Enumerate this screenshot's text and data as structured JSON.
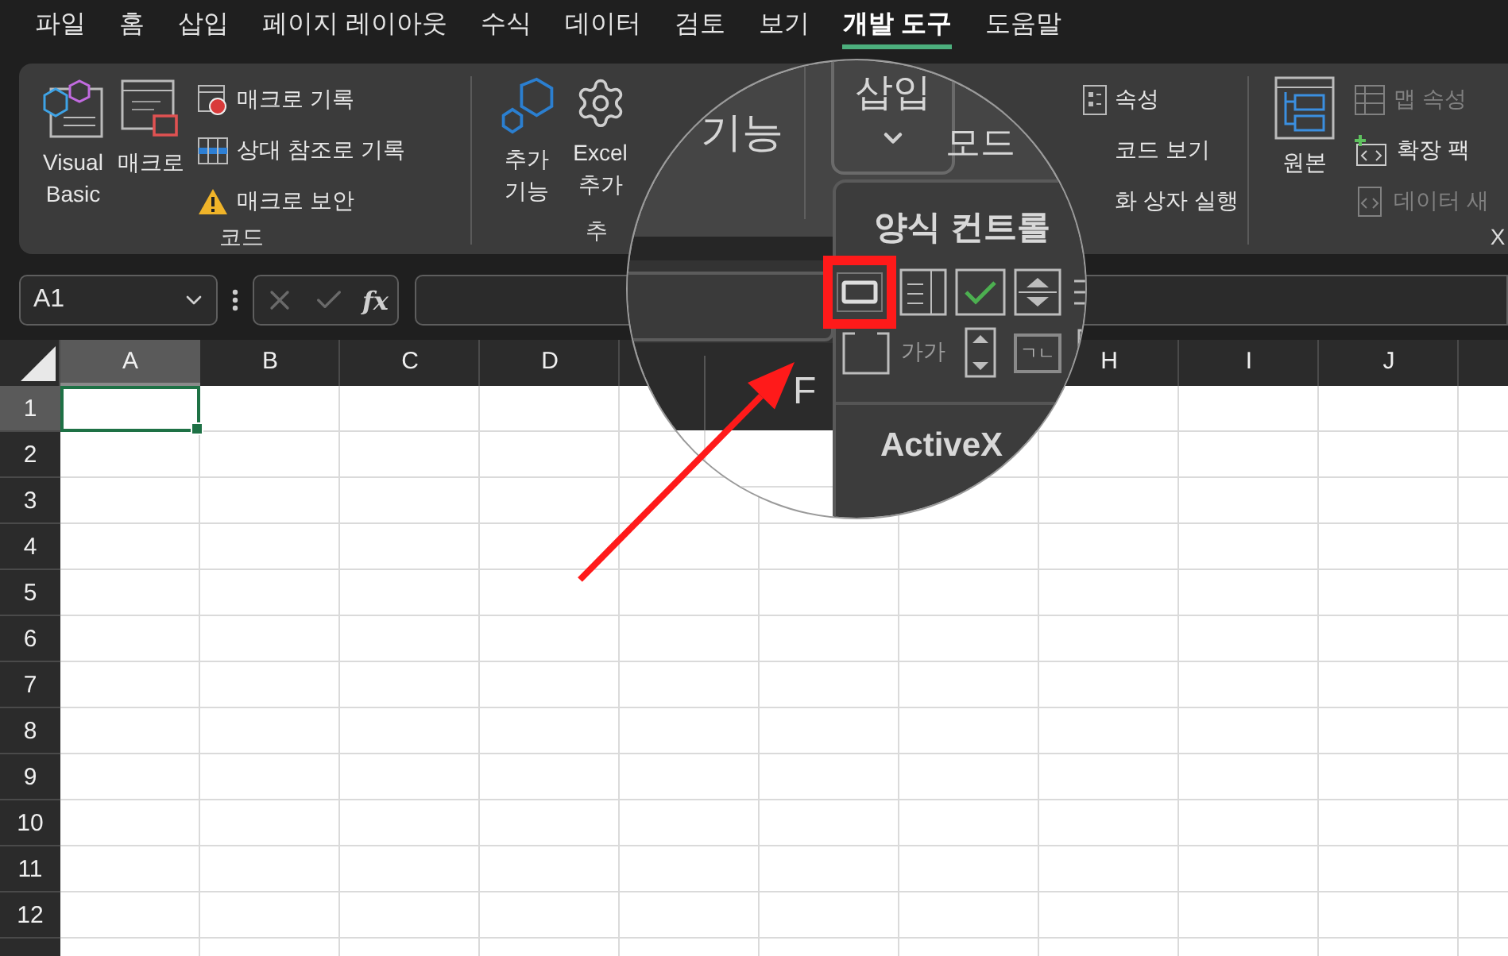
{
  "menu_tabs": [
    {
      "label": "파일",
      "selected": false
    },
    {
      "label": "홈",
      "selected": false
    },
    {
      "label": "삽입",
      "selected": false
    },
    {
      "label": "페이지 레이아웃",
      "selected": false
    },
    {
      "label": "수식",
      "selected": false
    },
    {
      "label": "데이터",
      "selected": false
    },
    {
      "label": "검토",
      "selected": false
    },
    {
      "label": "보기",
      "selected": false
    },
    {
      "label": "개발 도구",
      "selected": true
    },
    {
      "label": "도움말",
      "selected": false
    }
  ],
  "code_group": {
    "label": "코드",
    "large_buttons": [
      {
        "label": "Visual\nBasic"
      },
      {
        "label": "매크로"
      }
    ],
    "small_buttons": [
      {
        "label": "매크로 기록"
      },
      {
        "label": "상대 참조로 기록"
      },
      {
        "label": "매크로 보안"
      }
    ]
  },
  "addins_group": {
    "label": "추",
    "buttons": [
      {
        "label": "추가\n기능"
      },
      {
        "label": "Excel\n추가"
      }
    ]
  },
  "controls_group": {
    "small_buttons": [
      {
        "label": "속성"
      },
      {
        "label": "코드 보기"
      },
      {
        "label": "화 상자 실행"
      }
    ]
  },
  "xml_group": {
    "label": "X",
    "large_button": {
      "label": "원본"
    },
    "small_buttons": [
      {
        "label": "맵 속성",
        "disabled": true
      },
      {
        "label": "확장 팩",
        "disabled": false
      },
      {
        "label": "데이터 새",
        "disabled": true
      }
    ]
  },
  "formula_bar": {
    "name_box": "A1",
    "fx_label": "fx"
  },
  "sheet": {
    "columns": [
      {
        "kind": "header",
        "label": "A",
        "selected": true
      },
      {
        "kind": "header",
        "label": "B",
        "selected": false
      },
      {
        "kind": "header",
        "label": "C",
        "selected": false
      },
      {
        "kind": "header",
        "label": "D",
        "selected": false
      },
      {
        "kind": "blank"
      },
      {
        "kind": "blank"
      },
      {
        "kind": "blank"
      },
      {
        "kind": "header",
        "label": "H",
        "selected": false
      },
      {
        "kind": "header",
        "label": "I",
        "selected": false
      },
      {
        "kind": "header",
        "label": "J",
        "selected": false
      },
      {
        "kind": "blank"
      }
    ],
    "rows": [
      {
        "label": "1",
        "selected": true
      },
      {
        "label": "2",
        "selected": false
      },
      {
        "label": "3",
        "selected": false
      },
      {
        "label": "4",
        "selected": false
      },
      {
        "label": "5",
        "selected": false
      },
      {
        "label": "6",
        "selected": false
      },
      {
        "label": "7",
        "selected": false
      },
      {
        "label": "8",
        "selected": false
      },
      {
        "label": "9",
        "selected": false
      },
      {
        "label": "10",
        "selected": false
      },
      {
        "label": "11",
        "selected": false
      },
      {
        "label": "12",
        "selected": false
      }
    ]
  },
  "magnifier": {
    "ribbon_text": "기능",
    "insert_button": "삽입",
    "mode_text": "모드",
    "column_label": "F",
    "panel": {
      "title": "양식 컨트롤",
      "controls": [
        {
          "kind": "button",
          "selected": true
        },
        {
          "kind": "combo",
          "selected": false
        },
        {
          "kind": "checkbox",
          "selected": false
        },
        {
          "kind": "spin",
          "selected": false
        },
        {
          "kind": "listbox",
          "selected": false
        },
        {
          "kind": "groupbox",
          "selected": false
        },
        {
          "kind": "label",
          "text": "가가",
          "selected": false
        },
        {
          "kind": "scrollbar",
          "selected": false
        },
        {
          "kind": "option",
          "text": "ㄱㄴ",
          "selected": false
        },
        {
          "kind": "list",
          "selected": false
        }
      ],
      "activex_title": "ActiveX"
    }
  }
}
